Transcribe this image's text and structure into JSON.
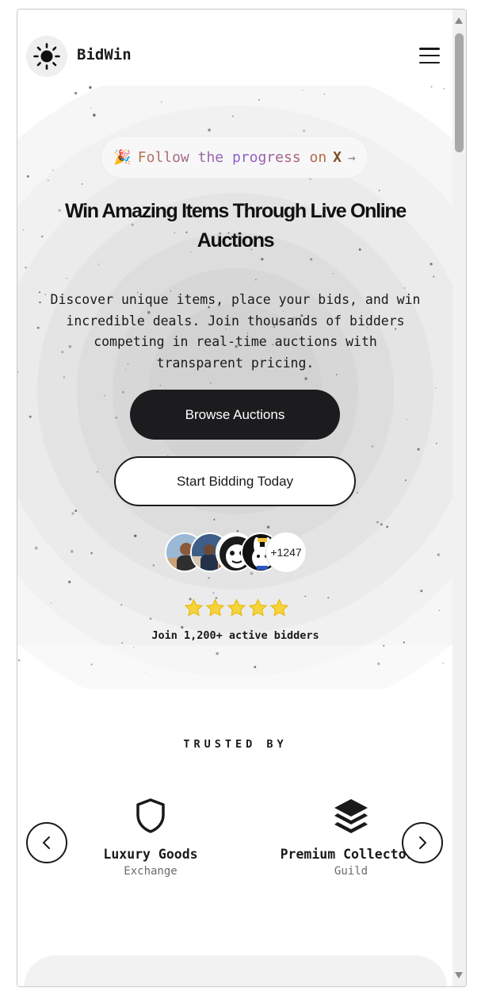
{
  "header": {
    "brand": "BidWin",
    "logo_icon": "sun-icon",
    "menu_icon": "hamburger-menu-icon"
  },
  "hero": {
    "announcement": {
      "emoji": "🎉",
      "text": "Follow the progress on",
      "x_label": "X",
      "arrow": "→"
    },
    "title": "Win Amazing Items Through Live Online Auctions",
    "description": "Discover unique items, place your bids, and win incredible deals. Join thousands of bidders competing in real-time auctions with transparent pricing.",
    "primary_button": "Browse Auctions",
    "secondary_button": "Start Bidding Today",
    "avatar_count": "+1247",
    "rating_stars": 5,
    "social_proof": "Join 1,200+ active bidders"
  },
  "trusted": {
    "title": "TRUSTED BY",
    "partners": [
      {
        "name": "Luxury Goods",
        "sub": "Exchange",
        "icon": "shield-icon"
      },
      {
        "name": "Premium Collectors",
        "sub": "Guild",
        "icon": "layers-icon"
      }
    ],
    "prev_icon": "chevron-left-icon",
    "next_icon": "chevron-right-icon"
  },
  "colors": {
    "primary_dark": "#1c1c1e",
    "star_yellow": "#f5d33a",
    "ring_grey": "#d6d6d6",
    "muted_text": "#6b6b6b"
  }
}
